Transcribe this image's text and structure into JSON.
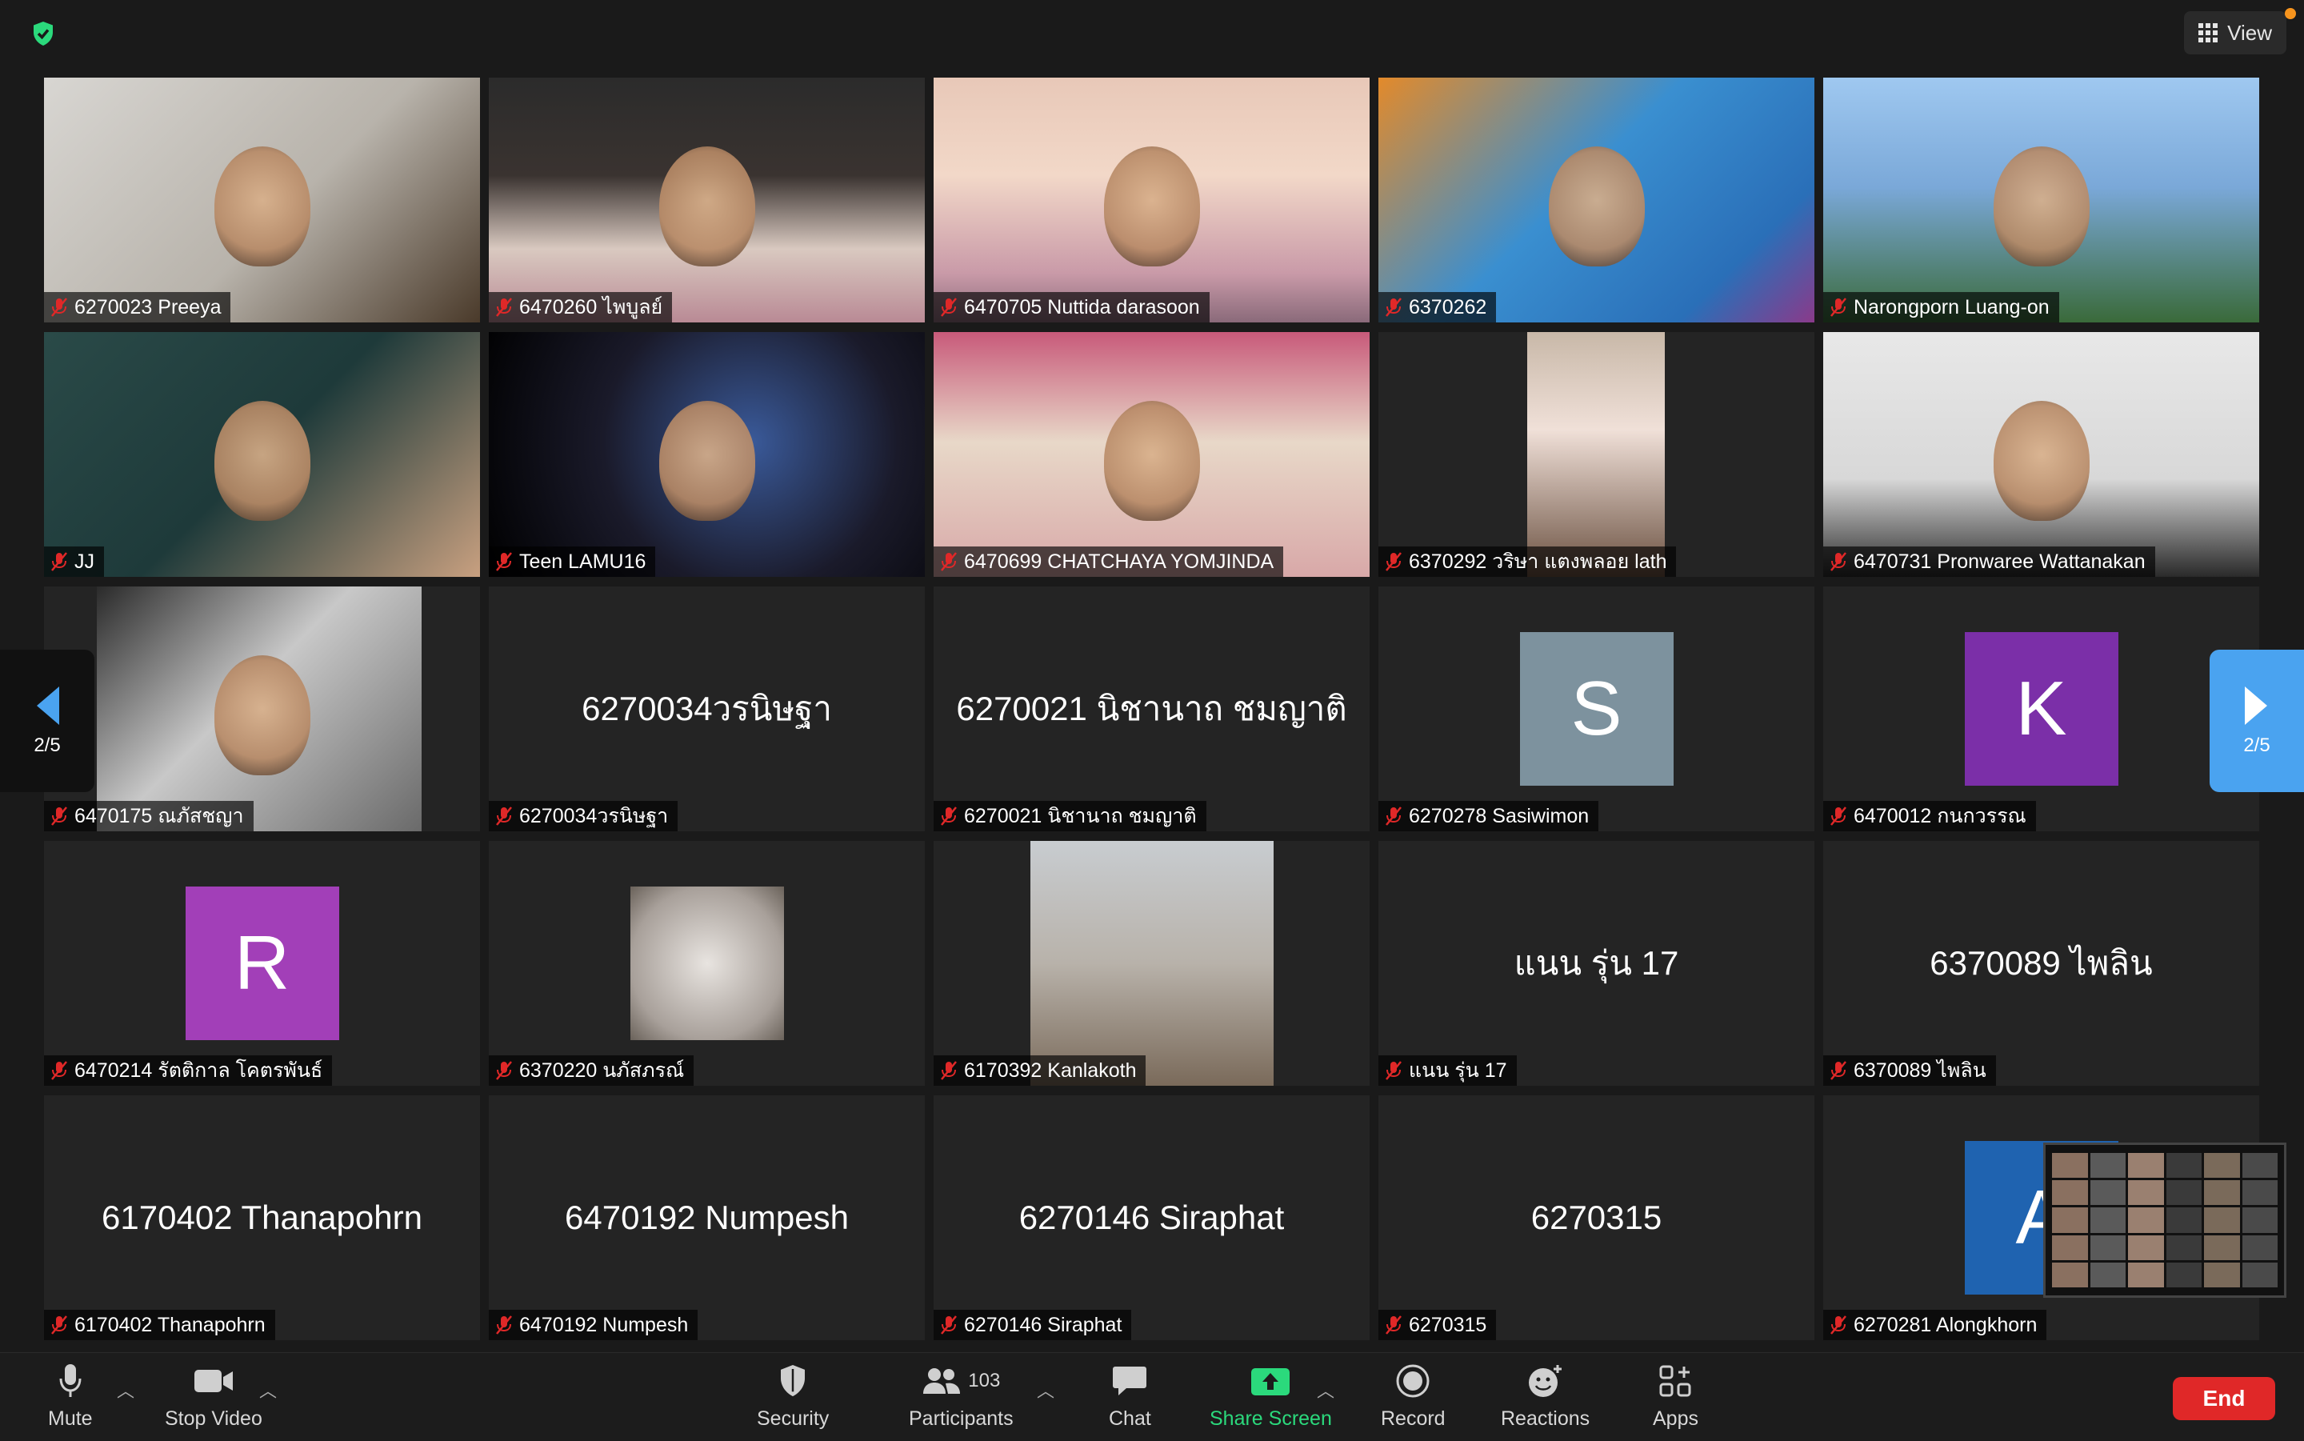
{
  "top": {
    "view_label": "View"
  },
  "pager": {
    "left": "2/5",
    "right": "2/5"
  },
  "tiles": [
    {
      "name": "6270023 Preeya"
    },
    {
      "name": "6470260 ไพบูลย์"
    },
    {
      "name": "6470705 Nuttida darasoon"
    },
    {
      "name": "6370262"
    },
    {
      "name": "Narongporn Luang-on"
    },
    {
      "name": "JJ"
    },
    {
      "name": "Teen LAMU16"
    },
    {
      "name": "6470699 CHATCHAYA YOMJINDA"
    },
    {
      "name": "6370292 วริษา แตงพลอย lath"
    },
    {
      "name": "6470731 Pronwaree Wattanakan"
    },
    {
      "name": "6470175 ณภัสชญา"
    },
    {
      "name": "6270034วรนิษฐา",
      "center": "6270034วรนิษฐา"
    },
    {
      "name": "6270021 นิชานาถ ชมญาติ",
      "center": "6270021 นิชานาถ ชมญาติ"
    },
    {
      "name": "6270278 Sasiwimon",
      "avatar": "S",
      "avatar_color": "#7d929e"
    },
    {
      "name": "6470012 กนกวรรณ",
      "avatar": "K",
      "avatar_color": "#7b2fa8"
    },
    {
      "name": "6470214 รัตติกาล โคตรพันธ์",
      "avatar": "R",
      "avatar_color": "#a23fb8"
    },
    {
      "name": "6370220 นภัสภรณ์"
    },
    {
      "name": "6170392 Kanlakoth"
    },
    {
      "name": "แนน รุ่น 17",
      "center": "แนน รุ่น 17"
    },
    {
      "name": "6370089 ไพลิน",
      "center": "6370089 ไพลิน"
    },
    {
      "name": "6170402 Thanapohrn",
      "center": "6170402 Thanapohrn"
    },
    {
      "name": "6470192 Numpesh",
      "center": "6470192 Numpesh"
    },
    {
      "name": "6270146 Siraphat",
      "center": "6270146 Siraphat"
    },
    {
      "name": "6270315",
      "center": "6270315"
    },
    {
      "name": "6270281 Alongkhorn",
      "avatar": "A",
      "avatar_color": "#1f63b0"
    }
  ],
  "toolbar": {
    "mute": "Mute",
    "stop_video": "Stop Video",
    "security": "Security",
    "participants": "Participants",
    "participants_count": "103",
    "chat": "Chat",
    "share_screen": "Share Screen",
    "record": "Record",
    "reactions": "Reactions",
    "apps": "Apps",
    "end": "End"
  },
  "colors": {
    "share_green": "#2bd97c",
    "end_red": "#e02828",
    "pager_blue": "#4aa3f0"
  }
}
